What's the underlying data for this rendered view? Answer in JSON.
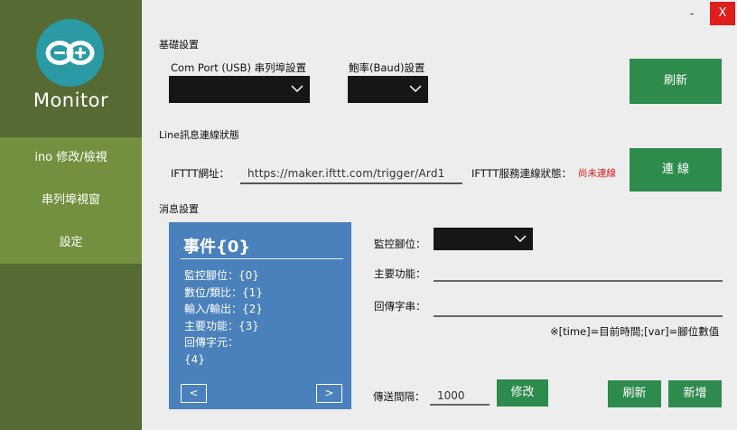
{
  "sidebar": {
    "app_name": "Monitor",
    "logo_icon": "arduino-logo",
    "items": [
      {
        "label": "ino 修改/檢視"
      },
      {
        "label": "串列埠視窗"
      },
      {
        "label": "設定"
      }
    ]
  },
  "window": {
    "minimize_label": "-",
    "close_label": "X"
  },
  "basic": {
    "section_title": "基礎設置",
    "com_port_label": "Com Port (USB) 串列埠設置",
    "com_port_value": "",
    "baud_label": "鮑率(Baud)設置",
    "baud_value": "",
    "refresh_label": "刷新"
  },
  "line": {
    "section_title": "Line訊息連線狀態",
    "ifttt_url_label": "IFTTT網址：",
    "ifttt_url_value": "https://maker.ifttt.com/trigger/Ard1",
    "service_status_label": "IFTTT服務連線狀態：",
    "service_status_value": "尚未連線",
    "connect_label": "連 線"
  },
  "message": {
    "section_title": "消息設置",
    "card": {
      "title": "事件{0}",
      "lines": [
        "監控腳位：{0}",
        "數位/類比：{1}",
        "輸入/輸出：{2}",
        "主要功能：{3}",
        "回傳字元：",
        "{4}"
      ],
      "prev_label": "<",
      "next_label": ">"
    },
    "monitor_pin_label": "監控腳位：",
    "monitor_pin_value": "",
    "main_function_label": "主要功能：",
    "main_function_value": "",
    "return_string_label": "回傳字串：",
    "return_string_value": "",
    "hint": "※[time]=目前時間;[var]=腳位數值",
    "send_interval_label": "傳送間隔：",
    "send_interval_value": "1000",
    "modify_label": "修改",
    "refresh_label": "刷新",
    "add_label": "新增"
  },
  "colors": {
    "sidebar_dark": "#566a33",
    "sidebar_nav": "#72903e",
    "accent_green": "#2e8b4e",
    "card_blue": "#4a80bb",
    "close_red": "#e01d1d"
  }
}
